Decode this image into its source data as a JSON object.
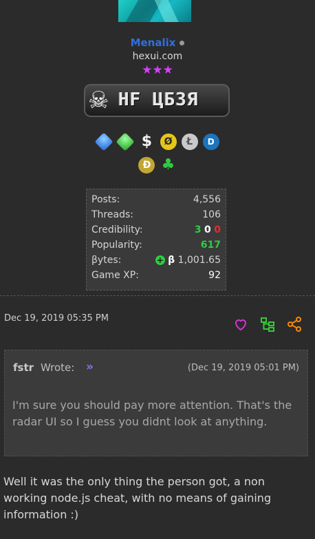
{
  "user": {
    "name": "Menalix",
    "usertitle": "hexui.com",
    "stars": "★★★",
    "badge_text": "HF ЦБЗЯ"
  },
  "awards": {
    "row1": [
      "sapphire-icon",
      "emerald-icon",
      "dollar-icon",
      "zero-coin-icon",
      "litecoin-icon",
      "dash-icon"
    ],
    "row2": [
      "dogecoin-icon",
      "clover-icon"
    ]
  },
  "stats": {
    "posts_label": "Posts:",
    "posts": "4,556",
    "threads_label": "Threads:",
    "threads": "106",
    "credibility_label": "Credibility:",
    "cred_pos": "3",
    "cred_neu": "0",
    "cred_neg": "0",
    "popularity_label": "Popularity:",
    "popularity": "617",
    "bytes_label": "βytes:",
    "bytes_symbol": "β",
    "bytes": "1,001.65",
    "gamexp_label": "Game XP:",
    "gamexp": "92"
  },
  "post": {
    "date": "Dec 19, 2019 05:35 PM",
    "actions": [
      "heart-icon",
      "tree-icon",
      "share-icon"
    ]
  },
  "quote": {
    "author": "fstr",
    "wrote": "Wrote:",
    "arrow": "»",
    "date": "(Dec 19, 2019 05:01 PM)",
    "body": "I'm sure you should pay more attention. That's the radar UI so I guess you didnt look at anything."
  },
  "reply": {
    "body": "Well it was the only thing the person got, a non working node.js cheat, with no means of gaining information :)"
  },
  "colors": {
    "background": "#2b2b2b",
    "username": "#2f6fe0",
    "stars": "#d740ff",
    "positive": "#2ecc40",
    "negative": "#e03030",
    "action_heart": "#d633d6",
    "action_tree": "#33cc33",
    "action_share": "#ff8800",
    "quote_arrow": "#7b7bea"
  }
}
